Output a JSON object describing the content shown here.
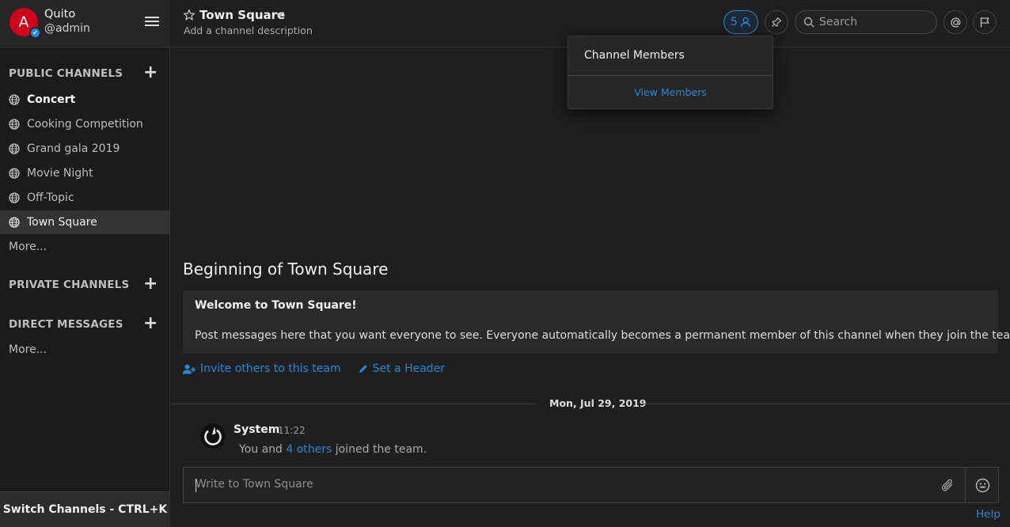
{
  "team": {
    "initial": "A",
    "name": "Quito",
    "username": "@admin"
  },
  "sidebar": {
    "public_title": "PUBLIC CHANNELS",
    "channels": [
      {
        "label": "Concert"
      },
      {
        "label": "Cooking Competition"
      },
      {
        "label": "Grand gala 2019"
      },
      {
        "label": "Movie Night"
      },
      {
        "label": "Off-Topic"
      },
      {
        "label": "Town Square"
      }
    ],
    "public_more": "More...",
    "private_title": "PRIVATE CHANNELS",
    "direct_title": "DIRECT MESSAGES",
    "direct_more": "More...",
    "switch_label": "Switch Channels - CTRL+K"
  },
  "header": {
    "title": "Town Square",
    "description": "Add a channel description",
    "member_count": "5",
    "search_placeholder": "Search"
  },
  "dropdown": {
    "title": "Channel Members",
    "link": "View Members"
  },
  "intro": {
    "title": "Beginning of Town Square",
    "welcome": "Welcome to Town Square!",
    "message": "Post messages here that you want everyone to see. Everyone automatically becomes a permanent member of this channel when they join the team.",
    "invite": "Invite others to this team",
    "set_header": "Set a Header"
  },
  "date_separator": "Mon, Jul 29, 2019",
  "post": {
    "author": "System",
    "time": "11:22",
    "prefix": "You and",
    "link": "4 others",
    "suffix": "joined the team."
  },
  "composer": {
    "placeholder": "Write to Town Square"
  },
  "help": "Help",
  "colors": {
    "accent": "#2389d7",
    "avatar": "#d0021b",
    "background": "#1f1f1f"
  }
}
